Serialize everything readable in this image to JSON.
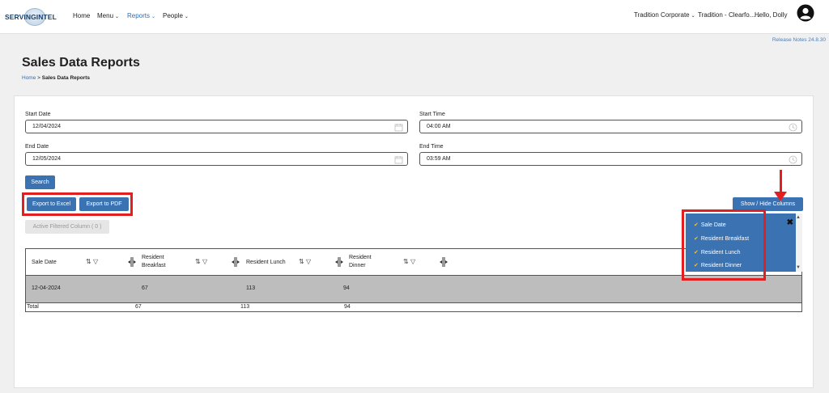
{
  "app": {
    "logo_text": "SERVINGINTEL",
    "nav": [
      {
        "label": "Home"
      },
      {
        "label": "Menu"
      },
      {
        "label": "Reports"
      },
      {
        "label": "People"
      }
    ],
    "org": "Tradition Corporate",
    "site": "Tradition - Clearfo...",
    "greeting": "Hello, Dolly",
    "release_notes": "Release Notes 24.8.30"
  },
  "page": {
    "title": "Sales Data Reports",
    "breadcrumb_home": "Home",
    "breadcrumb_sep": " > ",
    "breadcrumb_current": "Sales Data Reports"
  },
  "form": {
    "start_date_label": "Start Date",
    "start_date_value": "12/04/2024",
    "end_date_label": "End Date",
    "end_date_value": "12/05/2024",
    "start_time_label": "Start Time",
    "start_time_value": "04:00 AM",
    "end_time_label": "End Time",
    "end_time_value": "03:59 AM",
    "search_label": "Search",
    "export_excel_label": "Export to Excel",
    "export_pdf_label": "Export to PDF",
    "active_filtered_label": "Active Filtered Column ( 0 )",
    "show_hide_label": "Show / Hide Columns"
  },
  "table": {
    "columns": [
      {
        "label": "Sale Date"
      },
      {
        "label": "Resident Breakfast"
      },
      {
        "label": "Resident Lunch"
      },
      {
        "label": "Resident Dinner"
      }
    ],
    "rows": [
      [
        "12-04-2024",
        "67",
        "113",
        "94"
      ]
    ],
    "total": [
      "Total",
      "67",
      "113",
      "94"
    ],
    "sort_glyph": "⇅",
    "filter_glyph": "▽"
  },
  "column_menu": {
    "items": [
      {
        "label": "Sale Date",
        "checked": true
      },
      {
        "label": "Resident Breakfast",
        "checked": true
      },
      {
        "label": "Resident Lunch",
        "checked": true
      },
      {
        "label": "Resident Dinner",
        "checked": true
      }
    ],
    "close_glyph": "✖"
  },
  "icons": {
    "calendar": "calendar-icon",
    "clock": "clock-icon",
    "user": "user-icon",
    "column-resize": "column-resize-icon"
  },
  "colors": {
    "primary": "#3a72b2",
    "highlight": "#e31e1e",
    "row_bg": "#bdbdbd"
  }
}
